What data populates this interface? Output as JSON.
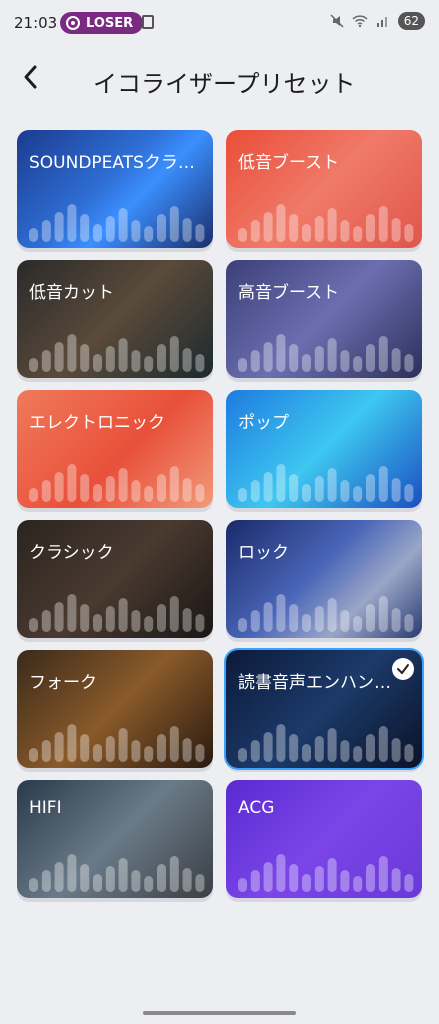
{
  "status_bar": {
    "time": "21:03",
    "pill_label": "LOSER",
    "battery": "62"
  },
  "header": {
    "back_icon": "chevron-left-icon",
    "title": "イコライザープリセット"
  },
  "presets": [
    {
      "label": "SOUNDPEATSクラ…",
      "selected": false,
      "bg": "linear-gradient(135deg,#1b3b8f 0%,#2f6fd6 45%,#3b8fff 60%,#1a2e6a 100%)"
    },
    {
      "label": "低音ブースト",
      "selected": false,
      "bg": "linear-gradient(135deg,#e94e3a 0%,#f07a68 50%,#e0554a 100%)"
    },
    {
      "label": "低音カット",
      "selected": false,
      "bg": "linear-gradient(135deg,#2a2a2a 0%,#5a4a3a 50%,#1c2a2e 100%)"
    },
    {
      "label": "高音ブースト",
      "selected": false,
      "bg": "linear-gradient(135deg,#3b3f78 0%,#6b6fb0 50%,#2b2f5a 100%)"
    },
    {
      "label": "エレクトロニック",
      "selected": false,
      "bg": "linear-gradient(135deg,#f07a5a 0%,#e8503a 55%,#f29a7a 100%)"
    },
    {
      "label": "ポップ",
      "selected": false,
      "bg": "linear-gradient(135deg,#1e7be0 0%,#3ec7f0 50%,#1a4ec0 100%)"
    },
    {
      "label": "クラシック",
      "selected": false,
      "bg": "linear-gradient(135deg,#2a2420 0%,#4a3a30 50%,#1a1614 100%)"
    },
    {
      "label": "ロック",
      "selected": false,
      "bg": "linear-gradient(135deg,#1a2a6a 0%,#4a66b8 45%,#9aa6c8 70%,#2a3a70 100%)"
    },
    {
      "label": "フォーク",
      "selected": false,
      "bg": "linear-gradient(135deg,#3a2a1a 0%,#8a5a2a 50%,#2a1a10 100%)"
    },
    {
      "label": "読書音声エンハン…",
      "selected": true,
      "bg": "linear-gradient(135deg,#0c1a3a 0%,#1c3a6a 50%,#0a1228 100%)"
    },
    {
      "label": "HIFI",
      "selected": false,
      "bg": "linear-gradient(135deg,#2a3a4a 0%,#6a7a88 50%,#3a3f44 100%)"
    },
    {
      "label": "ACG",
      "selected": false,
      "bg": "linear-gradient(135deg,#5a2ad0 0%,#7b45e8 50%,#6a38d8 100%)"
    }
  ],
  "colors": {
    "background": "#eceef2",
    "selected_border": "#3aa3ff"
  }
}
